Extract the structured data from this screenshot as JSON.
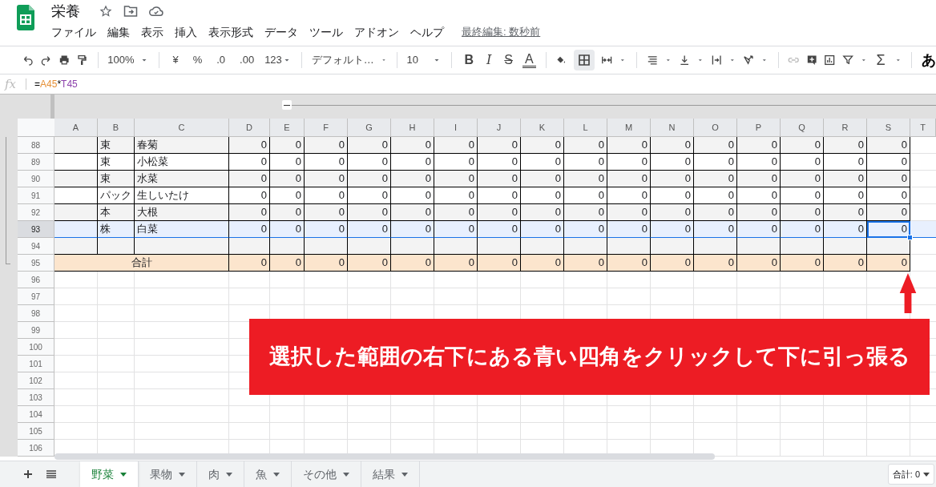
{
  "document": {
    "title": "栄養",
    "last_edit": "最終編集: 数秒前"
  },
  "menu": [
    "ファイル",
    "編集",
    "表示",
    "挿入",
    "表示形式",
    "データ",
    "ツール",
    "アドオン",
    "ヘルプ"
  ],
  "toolbar": {
    "zoom": "100%",
    "currency": "¥",
    "percent": "%",
    "decrease_decimal": ".0",
    "increase_decimal": ".00",
    "number_format": "123",
    "font": "デフォルト…",
    "font_size": "10",
    "bold": "B",
    "italic": "I",
    "strikethrough": "S",
    "text_color": "A",
    "functions": "Σ",
    "input_tool": "あ"
  },
  "formula_bar": {
    "label": "fx",
    "parts": [
      {
        "text": "=",
        "kind": "operator"
      },
      {
        "text": "A45",
        "kind": "reference",
        "color": "#e69138"
      },
      {
        "text": "*",
        "kind": "operator"
      },
      {
        "text": "T45",
        "kind": "reference",
        "color": "#8e44ad"
      }
    ]
  },
  "columns": [
    "A",
    "B",
    "C",
    "D",
    "E",
    "F",
    "G",
    "H",
    "I",
    "J",
    "K",
    "L",
    "M",
    "N",
    "O",
    "P",
    "Q",
    "R",
    "S",
    "T"
  ],
  "rows": [
    {
      "number": "88",
      "kind": "data",
      "selected": false,
      "unit": "束",
      "name": "春菊",
      "values": [
        "0",
        "0",
        "0",
        "0",
        "0",
        "0",
        "0",
        "0",
        "0",
        "0",
        "0",
        "0",
        "0",
        "0",
        "0",
        "0"
      ]
    },
    {
      "number": "89",
      "kind": "data",
      "selected": false,
      "unit": "束",
      "name": "小松菜",
      "values": [
        "0",
        "0",
        "0",
        "0",
        "0",
        "0",
        "0",
        "0",
        "0",
        "0",
        "0",
        "0",
        "0",
        "0",
        "0",
        "0"
      ]
    },
    {
      "number": "90",
      "kind": "data",
      "selected": false,
      "unit": "束",
      "name": "水菜",
      "values": [
        "0",
        "0",
        "0",
        "0",
        "0",
        "0",
        "0",
        "0",
        "0",
        "0",
        "0",
        "0",
        "0",
        "0",
        "0",
        "0"
      ]
    },
    {
      "number": "91",
      "kind": "data",
      "selected": false,
      "unit": "パック",
      "name": "生しいたけ",
      "values": [
        "0",
        "0",
        "0",
        "0",
        "0",
        "0",
        "0",
        "0",
        "0",
        "0",
        "0",
        "0",
        "0",
        "0",
        "0",
        "0"
      ]
    },
    {
      "number": "92",
      "kind": "data",
      "selected": false,
      "unit": "本",
      "name": "大根",
      "values": [
        "0",
        "0",
        "0",
        "0",
        "0",
        "0",
        "0",
        "0",
        "0",
        "0",
        "0",
        "0",
        "0",
        "0",
        "0",
        "0"
      ]
    },
    {
      "number": "93",
      "kind": "data",
      "selected": true,
      "unit": "株",
      "name": "白菜",
      "values": [
        "0",
        "0",
        "0",
        "0",
        "0",
        "0",
        "0",
        "0",
        "0",
        "0",
        "0",
        "0",
        "0",
        "0",
        "0",
        "0"
      ]
    },
    {
      "number": "94",
      "kind": "blank",
      "selected": false
    },
    {
      "number": "95",
      "kind": "total",
      "selected": false,
      "label": "合計",
      "values": [
        "0",
        "0",
        "0",
        "0",
        "0",
        "0",
        "0",
        "0",
        "0",
        "0",
        "0",
        "0",
        "0",
        "0",
        "0",
        "0"
      ]
    },
    {
      "number": "96",
      "kind": "empty",
      "selected": false
    },
    {
      "number": "97",
      "kind": "empty",
      "selected": false
    },
    {
      "number": "98",
      "kind": "empty",
      "selected": false
    },
    {
      "number": "99",
      "kind": "empty",
      "selected": false
    },
    {
      "number": "100",
      "kind": "empty",
      "selected": false
    },
    {
      "number": "101",
      "kind": "empty",
      "selected": false
    },
    {
      "number": "102",
      "kind": "empty",
      "selected": false
    },
    {
      "number": "103",
      "kind": "empty",
      "selected": false
    },
    {
      "number": "104",
      "kind": "empty",
      "selected": false
    },
    {
      "number": "105",
      "kind": "empty",
      "selected": false
    },
    {
      "number": "106",
      "kind": "empty",
      "selected": false
    }
  ],
  "sheets": [
    {
      "label": "野菜",
      "selected": true
    },
    {
      "label": "果物",
      "selected": false
    },
    {
      "label": "肉",
      "selected": false
    },
    {
      "label": "魚",
      "selected": false
    },
    {
      "label": "その他",
      "selected": false
    },
    {
      "label": "結果",
      "selected": false
    }
  ],
  "status": {
    "sum": "合計: 0"
  },
  "callout": {
    "text": "選択した範囲の右下にある青い四角をクリックして下に引っ張る"
  }
}
